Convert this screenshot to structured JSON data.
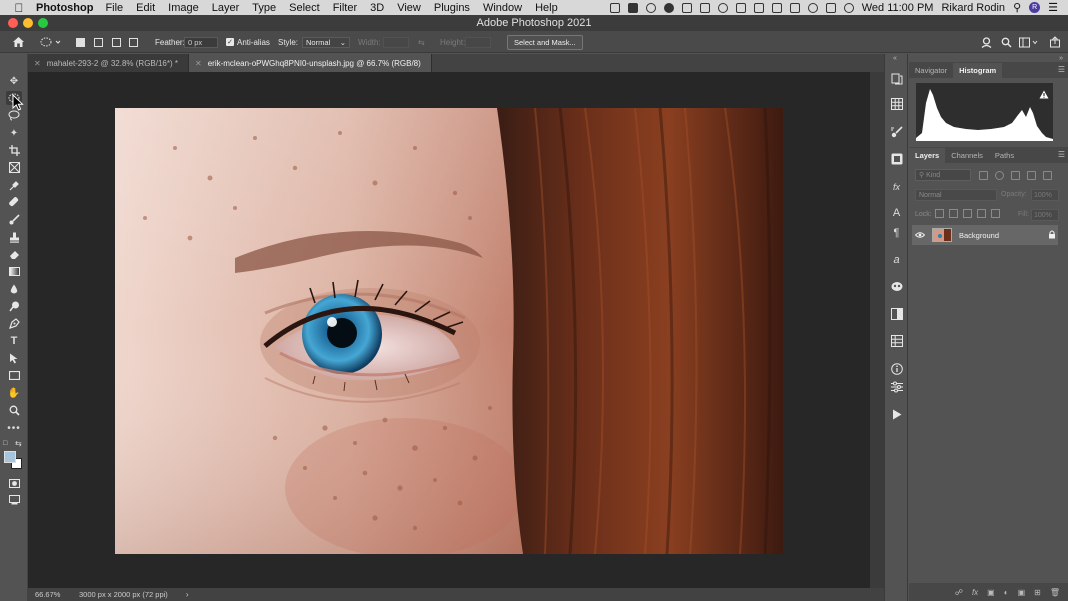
{
  "menubar": {
    "app_name": "Photoshop",
    "items": [
      "File",
      "Edit",
      "Image",
      "Layer",
      "Type",
      "Select",
      "Filter",
      "3D",
      "View",
      "Plugins",
      "Window",
      "Help"
    ],
    "clock": "Wed 11:00 PM",
    "user": "Rikard Rodin",
    "avatar_letter": "R"
  },
  "window": {
    "title": "Adobe Photoshop 2021"
  },
  "options_bar": {
    "feather_label": "Feather:",
    "feather_value": "0 px",
    "antialias_label": "Anti-alias",
    "style_label": "Style:",
    "style_value": "Normal",
    "width_label": "Width:",
    "height_label": "Height:",
    "select_mask_label": "Select and Mask..."
  },
  "doc_tabs": [
    {
      "label": "mahalet-293-2 @ 32.8% (RGB/16*) *",
      "active": false
    },
    {
      "label": "erik-mclean-oPWGhq8PNI0-unsplash.jpg @ 66.7% (RGB/8)",
      "active": true
    }
  ],
  "status_bar": {
    "zoom": "66.67%",
    "doc_info": "3000 px x 2000 px (72 ppi)"
  },
  "panels": {
    "top_tabs": [
      "Navigator",
      "Histogram"
    ],
    "top_active": "Histogram",
    "layer_tabs": [
      "Layers",
      "Channels",
      "Paths"
    ],
    "layer_active": "Layers",
    "kind_placeholder": "Kind",
    "blend_mode": "Normal",
    "opacity_label": "Opacity:",
    "opacity_value": "100%",
    "lock_label": "Lock:",
    "fill_label": "Fill:",
    "fill_value": "100%",
    "layers": [
      {
        "name": "Background",
        "visible": true,
        "locked": true
      }
    ]
  },
  "colors": {
    "foreground": "#a7c4dd",
    "background": "#ffffff",
    "accent": "#3c3c3c"
  }
}
